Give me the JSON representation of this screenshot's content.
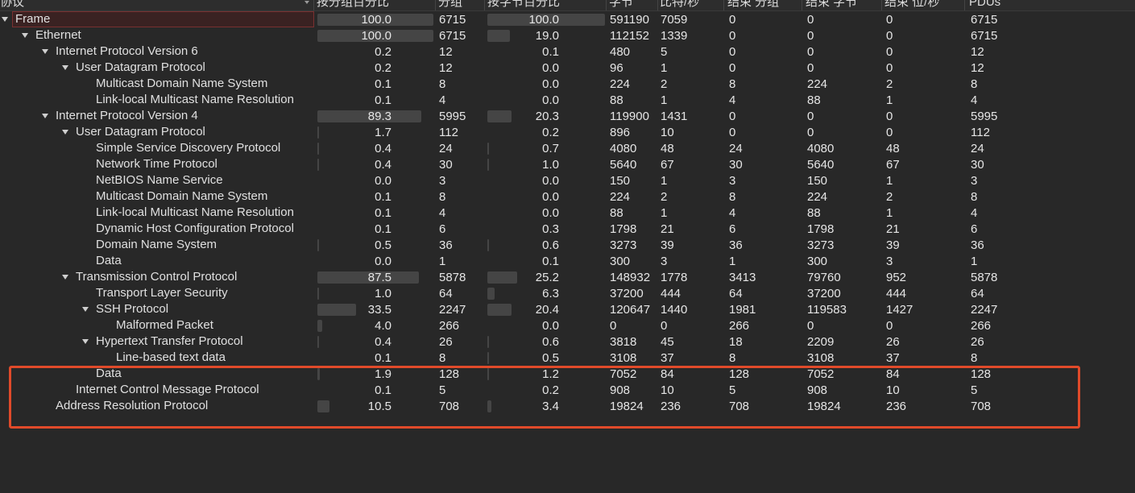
{
  "columns": [
    {
      "key": "protocol",
      "label": "协议"
    },
    {
      "key": "pct_packets",
      "label": "按分组百分比"
    },
    {
      "key": "packets",
      "label": "分组"
    },
    {
      "key": "pct_bytes",
      "label": "按字节百分比"
    },
    {
      "key": "bytes",
      "label": "字节"
    },
    {
      "key": "bits_per_sec",
      "label": "比特/秒"
    },
    {
      "key": "end_packets",
      "label": "结束 分组"
    },
    {
      "key": "end_bytes",
      "label": "结束 字节"
    },
    {
      "key": "end_bits_per_sec",
      "label": "结束 位/秒"
    },
    {
      "key": "pdus",
      "label": "PDUs"
    }
  ],
  "rows": [
    {
      "name": "Frame",
      "level": 0,
      "expanded": true,
      "selected": true,
      "pct_packets": "100.0",
      "packets": "6715",
      "pct_bytes": "100.0",
      "bytes": "591190",
      "bits_per_sec": "7059",
      "end_packets": "0",
      "end_bytes": "0",
      "end_bits_per_sec": "0",
      "pdus": "6715",
      "pkt_fill": 1.0,
      "byte_fill": 1.0
    },
    {
      "name": "Ethernet",
      "level": 1,
      "expanded": true,
      "pct_packets": "100.0",
      "packets": "6715",
      "pct_bytes": "19.0",
      "bytes": "112152",
      "bits_per_sec": "1339",
      "end_packets": "0",
      "end_bytes": "0",
      "end_bits_per_sec": "0",
      "pdus": "6715",
      "pkt_fill": 1.0,
      "byte_fill": 0.19
    },
    {
      "name": "Internet Protocol Version 6",
      "level": 2,
      "expanded": true,
      "pct_packets": "0.2",
      "packets": "12",
      "pct_bytes": "0.1",
      "bytes": "480",
      "bits_per_sec": "5",
      "end_packets": "0",
      "end_bytes": "0",
      "end_bits_per_sec": "0",
      "pdus": "12",
      "pkt_fill": 0.002,
      "byte_fill": 0.001
    },
    {
      "name": "User Datagram Protocol",
      "level": 3,
      "expanded": true,
      "pct_packets": "0.2",
      "packets": "12",
      "pct_bytes": "0.0",
      "bytes": "96",
      "bits_per_sec": "1",
      "end_packets": "0",
      "end_bytes": "0",
      "end_bits_per_sec": "0",
      "pdus": "12",
      "pkt_fill": 0.002,
      "byte_fill": 0.0
    },
    {
      "name": "Multicast Domain Name System",
      "level": 4,
      "pct_packets": "0.1",
      "packets": "8",
      "pct_bytes": "0.0",
      "bytes": "224",
      "bits_per_sec": "2",
      "end_packets": "8",
      "end_bytes": "224",
      "end_bits_per_sec": "2",
      "pdus": "8",
      "pkt_fill": 0.001,
      "byte_fill": 0.0
    },
    {
      "name": "Link-local Multicast Name Resolution",
      "level": 4,
      "pct_packets": "0.1",
      "packets": "4",
      "pct_bytes": "0.0",
      "bytes": "88",
      "bits_per_sec": "1",
      "end_packets": "4",
      "end_bytes": "88",
      "end_bits_per_sec": "1",
      "pdus": "4",
      "pkt_fill": 0.001,
      "byte_fill": 0.0
    },
    {
      "name": "Internet Protocol Version 4",
      "level": 2,
      "expanded": true,
      "pct_packets": "89.3",
      "packets": "5995",
      "pct_bytes": "20.3",
      "bytes": "119900",
      "bits_per_sec": "1431",
      "end_packets": "0",
      "end_bytes": "0",
      "end_bits_per_sec": "0",
      "pdus": "5995",
      "pkt_fill": 0.893,
      "byte_fill": 0.203
    },
    {
      "name": "User Datagram Protocol",
      "level": 3,
      "expanded": true,
      "pct_packets": "1.7",
      "packets": "112",
      "pct_bytes": "0.2",
      "bytes": "896",
      "bits_per_sec": "10",
      "end_packets": "0",
      "end_bytes": "0",
      "end_bits_per_sec": "0",
      "pdus": "112",
      "pkt_fill": 0.017,
      "byte_fill": 0.002
    },
    {
      "name": "Simple Service Discovery Protocol",
      "level": 4,
      "pct_packets": "0.4",
      "packets": "24",
      "pct_bytes": "0.7",
      "bytes": "4080",
      "bits_per_sec": "48",
      "end_packets": "24",
      "end_bytes": "4080",
      "end_bits_per_sec": "48",
      "pdus": "24",
      "pkt_fill": 0.004,
      "byte_fill": 0.007
    },
    {
      "name": "Network Time Protocol",
      "level": 4,
      "pct_packets": "0.4",
      "packets": "30",
      "pct_bytes": "1.0",
      "bytes": "5640",
      "bits_per_sec": "67",
      "end_packets": "30",
      "end_bytes": "5640",
      "end_bits_per_sec": "67",
      "pdus": "30",
      "pkt_fill": 0.004,
      "byte_fill": 0.01
    },
    {
      "name": "NetBIOS Name Service",
      "level": 4,
      "pct_packets": "0.0",
      "packets": "3",
      "pct_bytes": "0.0",
      "bytes": "150",
      "bits_per_sec": "1",
      "end_packets": "3",
      "end_bytes": "150",
      "end_bits_per_sec": "1",
      "pdus": "3",
      "pkt_fill": 0.0,
      "byte_fill": 0.0
    },
    {
      "name": "Multicast Domain Name System",
      "level": 4,
      "pct_packets": "0.1",
      "packets": "8",
      "pct_bytes": "0.0",
      "bytes": "224",
      "bits_per_sec": "2",
      "end_packets": "8",
      "end_bytes": "224",
      "end_bits_per_sec": "2",
      "pdus": "8",
      "pkt_fill": 0.001,
      "byte_fill": 0.0
    },
    {
      "name": "Link-local Multicast Name Resolution",
      "level": 4,
      "pct_packets": "0.1",
      "packets": "4",
      "pct_bytes": "0.0",
      "bytes": "88",
      "bits_per_sec": "1",
      "end_packets": "4",
      "end_bytes": "88",
      "end_bits_per_sec": "1",
      "pdus": "4",
      "pkt_fill": 0.001,
      "byte_fill": 0.0
    },
    {
      "name": "Dynamic Host Configuration Protocol",
      "level": 4,
      "pct_packets": "0.1",
      "packets": "6",
      "pct_bytes": "0.3",
      "bytes": "1798",
      "bits_per_sec": "21",
      "end_packets": "6",
      "end_bytes": "1798",
      "end_bits_per_sec": "21",
      "pdus": "6",
      "pkt_fill": 0.001,
      "byte_fill": 0.003
    },
    {
      "name": "Domain Name System",
      "level": 4,
      "pct_packets": "0.5",
      "packets": "36",
      "pct_bytes": "0.6",
      "bytes": "3273",
      "bits_per_sec": "39",
      "end_packets": "36",
      "end_bytes": "3273",
      "end_bits_per_sec": "39",
      "pdus": "36",
      "pkt_fill": 0.005,
      "byte_fill": 0.006
    },
    {
      "name": "Data",
      "level": 4,
      "pct_packets": "0.0",
      "packets": "1",
      "pct_bytes": "0.1",
      "bytes": "300",
      "bits_per_sec": "3",
      "end_packets": "1",
      "end_bytes": "300",
      "end_bits_per_sec": "3",
      "pdus": "1",
      "pkt_fill": 0.0,
      "byte_fill": 0.001
    },
    {
      "name": "Transmission Control Protocol",
      "level": 3,
      "expanded": true,
      "pct_packets": "87.5",
      "packets": "5878",
      "pct_bytes": "25.2",
      "bytes": "148932",
      "bits_per_sec": "1778",
      "end_packets": "3413",
      "end_bytes": "79760",
      "end_bits_per_sec": "952",
      "pdus": "5878",
      "pkt_fill": 0.875,
      "byte_fill": 0.252
    },
    {
      "name": "Transport Layer Security",
      "level": 4,
      "pct_packets": "1.0",
      "packets": "64",
      "pct_bytes": "6.3",
      "bytes": "37200",
      "bits_per_sec": "444",
      "end_packets": "64",
      "end_bytes": "37200",
      "end_bits_per_sec": "444",
      "pdus": "64",
      "pkt_fill": 0.01,
      "byte_fill": 0.063
    },
    {
      "name": "SSH Protocol",
      "level": 4,
      "expanded": true,
      "pct_packets": "33.5",
      "packets": "2247",
      "pct_bytes": "20.4",
      "bytes": "120647",
      "bits_per_sec": "1440",
      "end_packets": "1981",
      "end_bytes": "119583",
      "end_bits_per_sec": "1427",
      "pdus": "2247",
      "pkt_fill": 0.335,
      "byte_fill": 0.204
    },
    {
      "name": "Malformed Packet",
      "level": 5,
      "pct_packets": "4.0",
      "packets": "266",
      "pct_bytes": "0.0",
      "bytes": "0",
      "bits_per_sec": "0",
      "end_packets": "266",
      "end_bytes": "0",
      "end_bits_per_sec": "0",
      "pdus": "266",
      "pkt_fill": 0.04,
      "byte_fill": 0.0
    },
    {
      "name": "Hypertext Transfer Protocol",
      "level": 4,
      "expanded": true,
      "pct_packets": "0.4",
      "packets": "26",
      "pct_bytes": "0.6",
      "bytes": "3818",
      "bits_per_sec": "45",
      "end_packets": "18",
      "end_bytes": "2209",
      "end_bits_per_sec": "26",
      "pdus": "26",
      "pkt_fill": 0.004,
      "byte_fill": 0.006
    },
    {
      "name": "Line-based text data",
      "level": 5,
      "pct_packets": "0.1",
      "packets": "8",
      "pct_bytes": "0.5",
      "bytes": "3108",
      "bits_per_sec": "37",
      "end_packets": "8",
      "end_bytes": "3108",
      "end_bits_per_sec": "37",
      "pdus": "8",
      "pkt_fill": 0.001,
      "byte_fill": 0.005
    },
    {
      "name": "Data",
      "level": 4,
      "pct_packets": "1.9",
      "packets": "128",
      "pct_bytes": "1.2",
      "bytes": "7052",
      "bits_per_sec": "84",
      "end_packets": "128",
      "end_bytes": "7052",
      "end_bits_per_sec": "84",
      "pdus": "128",
      "pkt_fill": 0.019,
      "byte_fill": 0.012
    },
    {
      "name": "Internet Control Message Protocol",
      "level": 3,
      "pct_packets": "0.1",
      "packets": "5",
      "pct_bytes": "0.2",
      "bytes": "908",
      "bits_per_sec": "10",
      "end_packets": "5",
      "end_bytes": "908",
      "end_bits_per_sec": "10",
      "pdus": "5",
      "pkt_fill": 0.001,
      "byte_fill": 0.002
    },
    {
      "name": "Address Resolution Protocol",
      "level": 2,
      "pct_packets": "10.5",
      "packets": "708",
      "pct_bytes": "3.4",
      "bytes": "19824",
      "bits_per_sec": "236",
      "end_packets": "708",
      "end_bytes": "19824",
      "end_bits_per_sec": "236",
      "pdus": "708",
      "pkt_fill": 0.105,
      "byte_fill": 0.034
    }
  ],
  "colors": {
    "background": "#282828",
    "bar": "#454545",
    "highlight_box": "#e04a2a",
    "selected_border": "#7a3030"
  }
}
